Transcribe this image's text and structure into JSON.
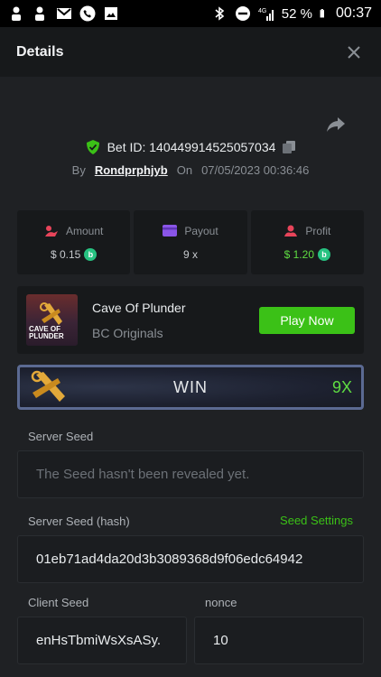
{
  "statusbar": {
    "battery": "52 %",
    "time": "00:37",
    "network": "4G"
  },
  "header": {
    "title": "Details"
  },
  "bet": {
    "id_label": "Bet ID: 140449914525057034",
    "by_label": "By",
    "user": "Rondprphjyb",
    "on_label": "On",
    "date": "07/05/2023 00:36:46"
  },
  "stats": {
    "amount_label": "Amount",
    "amount_value": "$ 0.15",
    "payout_label": "Payout",
    "payout_value": "9 x",
    "profit_label": "Profit",
    "profit_value": "$ 1.20"
  },
  "game": {
    "name": "Cave Of Plunder",
    "provider": "BC Originals",
    "thumb_text": "CAVE OF PLUNDER",
    "play_label": "Play Now"
  },
  "result": {
    "label": "WIN",
    "multiplier": "9X"
  },
  "seeds": {
    "server_seed_label": "Server Seed",
    "server_seed_value": "The Seed hasn't been revealed yet.",
    "server_hash_label": "Server Seed (hash)",
    "seed_settings_label": "Seed Settings",
    "server_hash_value": "01eb71ad4da20d3b3089368d9f06edc64942",
    "client_seed_label": "Client Seed",
    "client_seed_value": "enHsTbmiWsXsASy.",
    "nonce_label": "nonce",
    "nonce_value": "10"
  },
  "colors": {
    "accent_green": "#3bc117",
    "profit_green": "#5fdd42",
    "background": "#1f2124",
    "panel": "#17191b"
  }
}
